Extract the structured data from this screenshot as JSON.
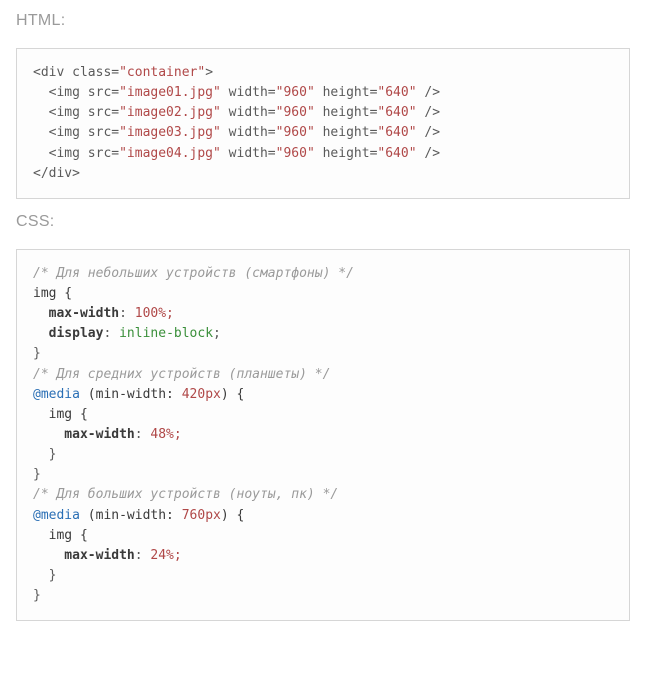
{
  "labels": {
    "html": "HTML:",
    "css": "CSS:"
  },
  "html_block": {
    "open_div_pre": "<div class=",
    "open_div_val": "\"container\"",
    "open_div_post": ">",
    "imgs": [
      {
        "pre": "  <img src=",
        "src": "\"image01.jpg\"",
        "wlab": " width=",
        "w": "\"960\"",
        "hlab": " height=",
        "h": "\"640\"",
        "tail": " />"
      },
      {
        "pre": "  <img src=",
        "src": "\"image02.jpg\"",
        "wlab": " width=",
        "w": "\"960\"",
        "hlab": " height=",
        "h": "\"640\"",
        "tail": " />"
      },
      {
        "pre": "  <img src=",
        "src": "\"image03.jpg\"",
        "wlab": " width=",
        "w": "\"960\"",
        "hlab": " height=",
        "h": "\"640\"",
        "tail": " />"
      },
      {
        "pre": "  <img src=",
        "src": "\"image04.jpg\"",
        "wlab": " width=",
        "w": "\"960\"",
        "hlab": " height=",
        "h": "\"640\"",
        "tail": " />"
      }
    ],
    "close_div": "</div>"
  },
  "css_block": {
    "c1": "/* Для небольших устройств (смартфоны) */",
    "sel1": "img {",
    "p1a": "  max-width",
    "v1a": " 100%;",
    "p1b": "  display",
    "v1b": " inline-block",
    "end1": "}",
    "c2": "/* Для средних устройств (планшеты) */",
    "mq1_at": "@media",
    "mq1_rest": " (min-width: ",
    "mq1_val": "420px",
    "mq1_close": ") {",
    "mq1_sel": "  img {",
    "mq1_prop": "    max-width",
    "mq1_valpct": " 48%;",
    "mq1_end_inner": "  }",
    "mq1_end": "}",
    "c3": "/* Для больших устройств (ноуты, пк) */",
    "mq2_at": "@media",
    "mq2_rest": " (min-width: ",
    "mq2_val": "760px",
    "mq2_close": ") {",
    "mq2_sel": "  img {",
    "mq2_prop": "    max-width",
    "mq2_valpct": " 24%;",
    "mq2_end_inner": "  }",
    "mq2_end": "}"
  }
}
